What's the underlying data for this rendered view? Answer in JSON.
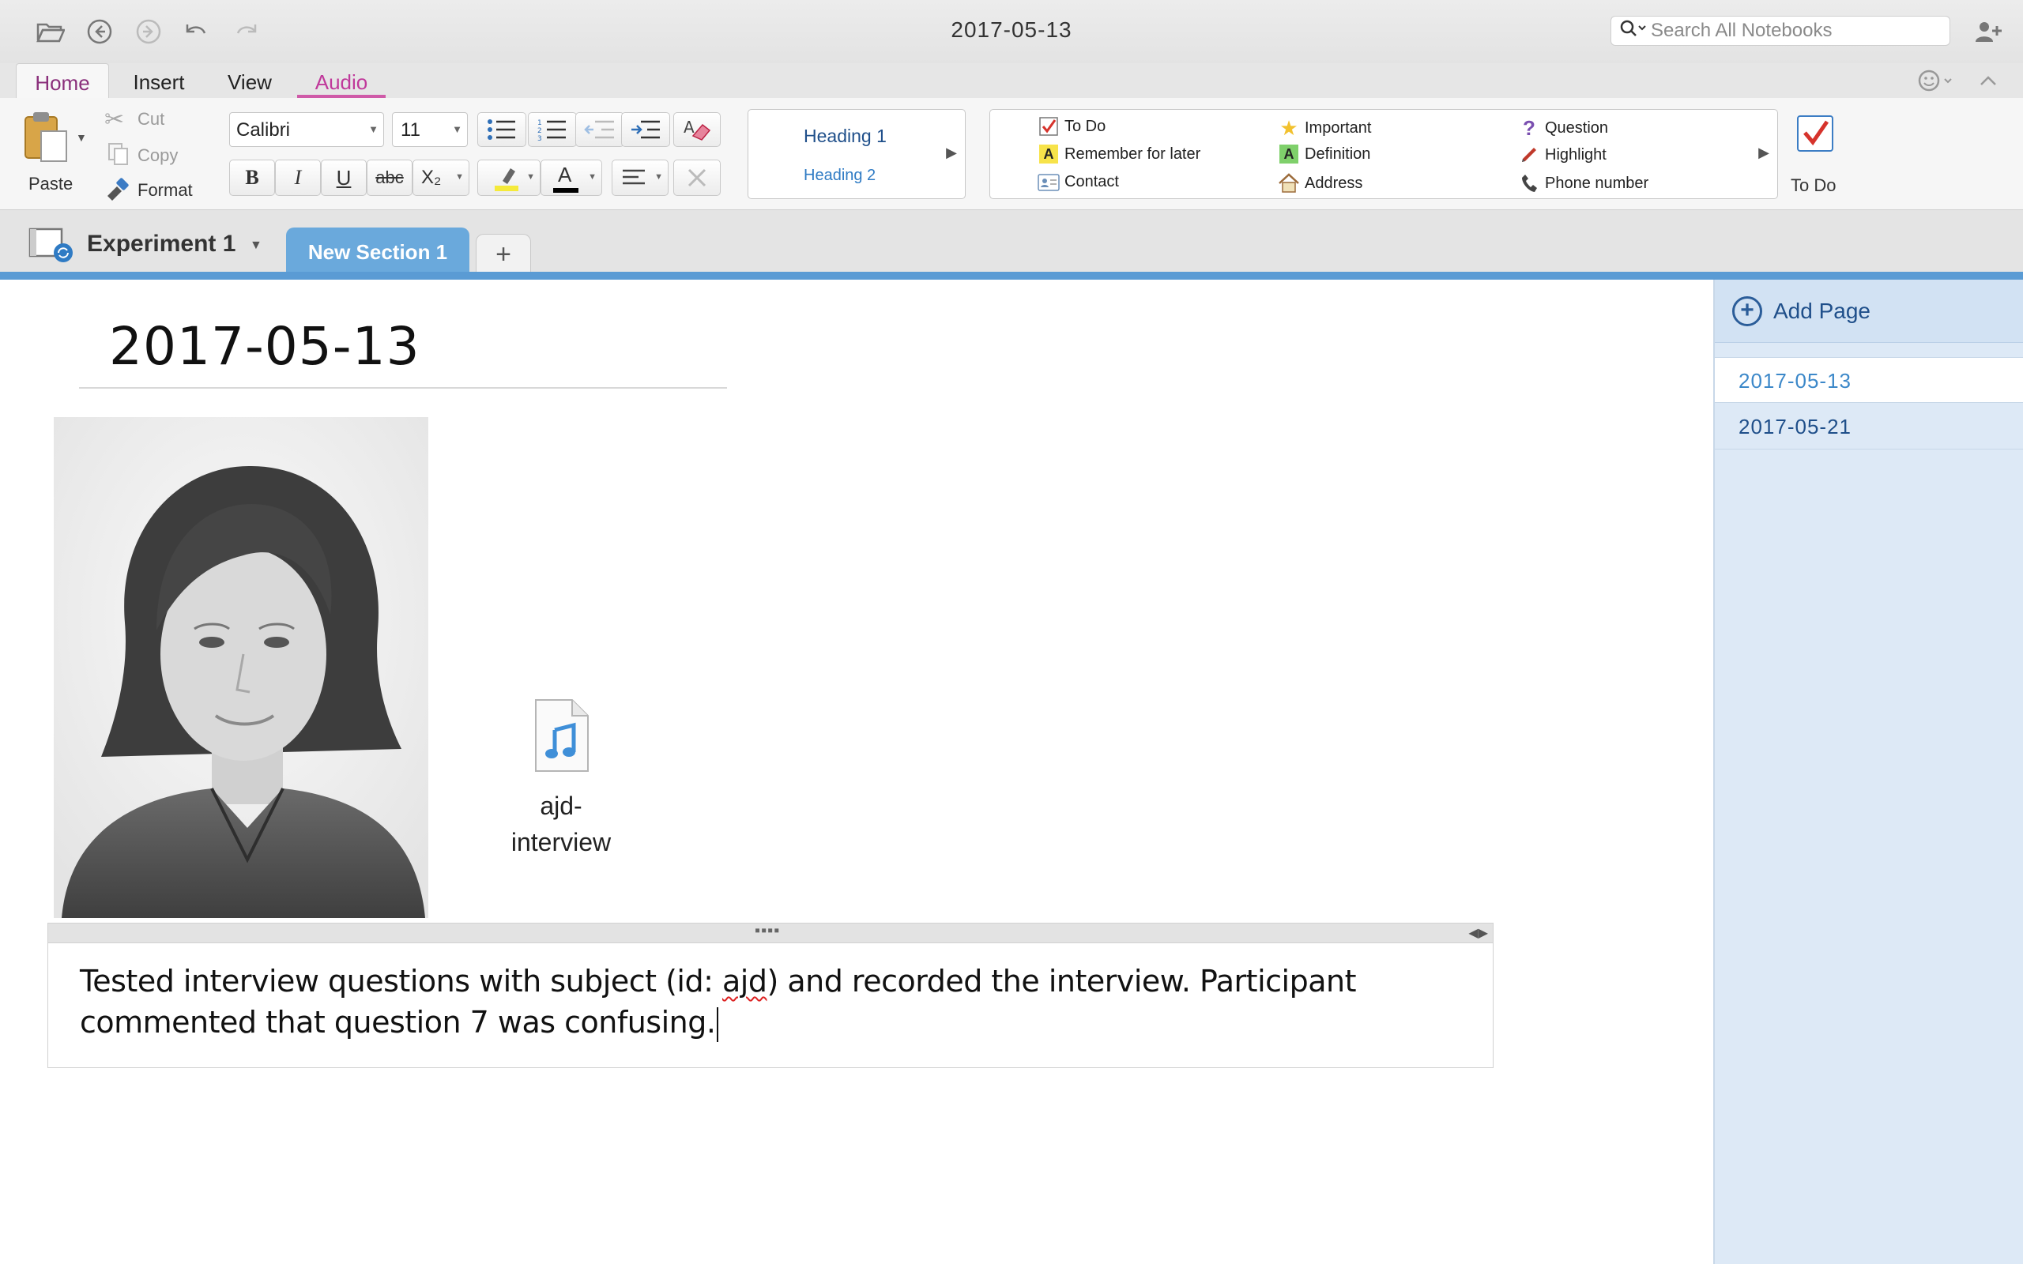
{
  "window": {
    "title": "2017-05-13"
  },
  "search": {
    "placeholder": "Search All Notebooks"
  },
  "ribbon": {
    "tabs": [
      {
        "label": "Home"
      },
      {
        "label": "Insert"
      },
      {
        "label": "View"
      },
      {
        "label": "Audio"
      }
    ],
    "clipboard": {
      "paste": "Paste",
      "cut": "Cut",
      "copy": "Copy",
      "format": "Format"
    },
    "font": {
      "name": "Calibri",
      "size": "11",
      "bold": "B",
      "italic": "I",
      "underline": "U",
      "strike": "abc",
      "subscript": "X₂",
      "font_color_glyph": "A"
    },
    "styles": {
      "heading1": "Heading 1",
      "heading2": "Heading 2"
    },
    "tags": {
      "todo": "To Do",
      "remember": "Remember for later",
      "contact": "Contact",
      "important": "Important",
      "definition": "Definition",
      "address": "Address",
      "question": "Question",
      "highlight": "Highlight",
      "phone": "Phone number"
    },
    "todo_button": "To Do"
  },
  "notebook": {
    "name": "Experiment 1"
  },
  "section": {
    "name": "New Section 1",
    "add_symbol": "+"
  },
  "page": {
    "title": "2017-05-13",
    "attachment": {
      "name": "ajd-interview",
      "caption_line1": "ajd-",
      "caption_line2": "interview",
      "type": "audio-file-icon"
    },
    "note": {
      "before": "Tested interview questions with subject (id: ",
      "misspelled": "ajd",
      "after": ") and recorded the interview. Participant commented that question 7 was confusing."
    }
  },
  "pages_pane": {
    "add_page": "Add Page",
    "pages": [
      {
        "title": "2017-05-13"
      },
      {
        "title": "2017-05-21"
      }
    ]
  },
  "colors": {
    "accent_section": "#6aa9dc",
    "home_tab_text": "#8a2f7b",
    "audio_tab": "#cf5aa8",
    "pages_pane_bg": "#dde9f6",
    "highlight_yellow": "#f5ea3b"
  }
}
